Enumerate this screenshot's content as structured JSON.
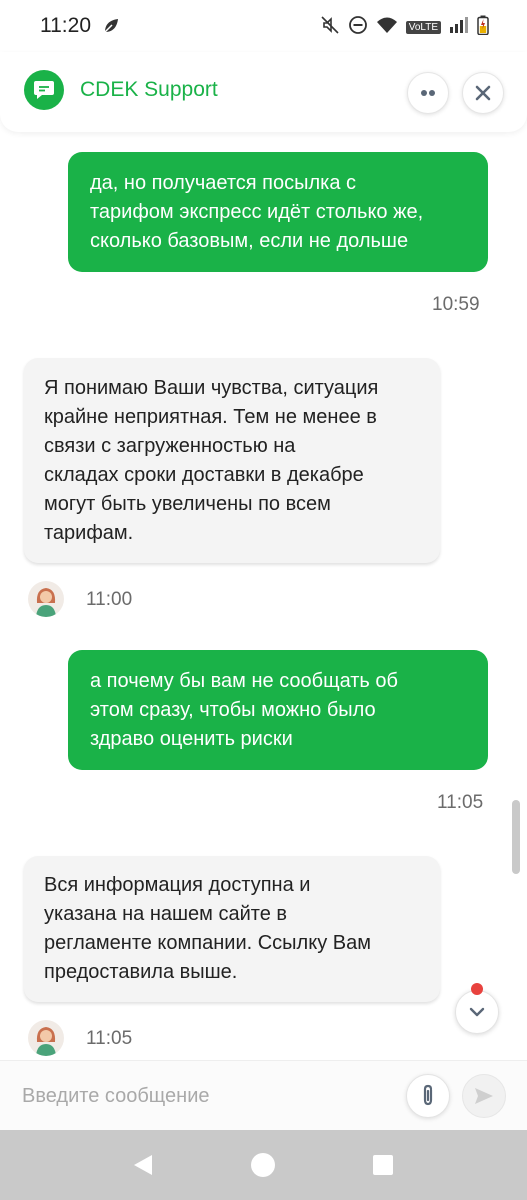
{
  "status_bar": {
    "time": "11:20",
    "network_label": "VoLTE"
  },
  "header": {
    "title": "CDEK Support",
    "icons": {
      "logo": "chat-bubble-icon",
      "more": "more-dots-icon",
      "close": "close-icon"
    }
  },
  "messages": [
    {
      "sender": "user",
      "lines": [
        "да, но получается посылка с",
        "тарифом экспресс идёт столько же,",
        "сколько базовым, если не дольше"
      ],
      "time": "10:59"
    },
    {
      "sender": "agent",
      "lines": [
        "Я понимаю Ваши чувства, ситуация",
        "крайне неприятная. Тем не менее в",
        "связи с загруженностью на",
        "складах сроки доставки в декабре",
        "могут быть увеличены по всем",
        "тарифам."
      ],
      "time": "11:00"
    },
    {
      "sender": "user",
      "lines": [
        "а почему бы вам не сообщать об",
        "этом сразу, чтобы можно было",
        "здраво оценить риски"
      ],
      "time": "11:05"
    },
    {
      "sender": "agent",
      "lines": [
        "Вся информация доступна и",
        "указана на нашем сайте в",
        "регламенте компании. Ссылку Вам",
        "предоставила выше."
      ],
      "time": "11:05"
    }
  ],
  "input": {
    "placeholder": "Введите сообщение",
    "value": ""
  },
  "colors": {
    "brand": "#1ab248",
    "agent_bubble": "#f4f4f4",
    "unread_dot": "#e8423e"
  }
}
